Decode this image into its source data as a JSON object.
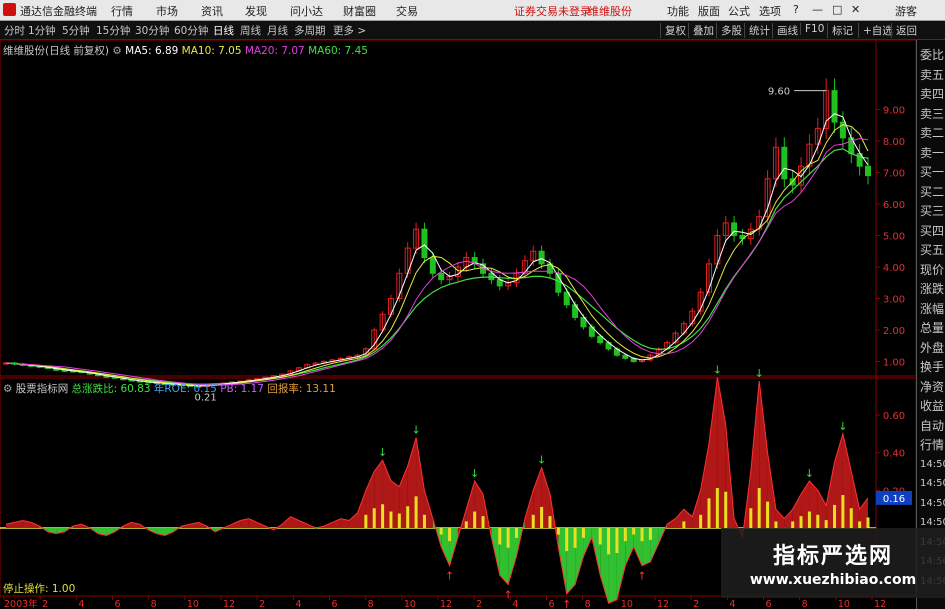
{
  "menubar": {
    "app_title": "通达信金融终端",
    "menus": [
      "行情",
      "市场",
      "资讯",
      "发现",
      "问小达",
      "财富圈",
      "交易"
    ],
    "login_text": "证券交易未登录",
    "stock_link": "维维股份",
    "right_menus": [
      "功能",
      "版面",
      "公式",
      "选项"
    ],
    "guest": "游客"
  },
  "timeframes": [
    "分时",
    "1分钟",
    "5分钟",
    "15分钟",
    "30分钟",
    "60分钟",
    "日线",
    "周线",
    "月线",
    "多周期",
    "更多 >"
  ],
  "selected_timeframe": "日线",
  "toolbar": [
    "复权",
    "叠加",
    "多股",
    "统计",
    "画线",
    "F10",
    "标记",
    "+自选",
    "返回"
  ],
  "main_legend": {
    "stock": "维维股份(日线 前复权)",
    "ma5": "MA5: 6.89",
    "ma10": "MA10: 7.05",
    "ma20": "MA20: 7.07",
    "ma60": "MA60: 7.45"
  },
  "price_axis": [
    "9.00",
    "8.00",
    "7.00",
    "6.00",
    "5.00",
    "4.00",
    "3.00",
    "2.00",
    "1.00"
  ],
  "price_annotations": {
    "high": "9.60",
    "low": "0.21"
  },
  "indicator_legend": {
    "name": "股票指标网",
    "total": "总涨跌比: 60.83",
    "roe": "年ROE: 0.15",
    "pb": "PB: 1.17",
    "ret": "回报率: 13.11"
  },
  "indicator_axis": [
    "0.60",
    "0.40",
    "0.20"
  ],
  "indicator_current": "0.16",
  "stop_text": "停止操作: 1.00",
  "x_axis": [
    "2003年",
    "2",
    "4",
    "6",
    "8",
    "10",
    "12",
    "2",
    "4",
    "6",
    "8",
    "10",
    "12",
    "2",
    "4",
    "6",
    "8",
    "10",
    "12",
    "2",
    "4",
    "6",
    "8",
    "10",
    "12"
  ],
  "side_labels": [
    "委比",
    "卖五",
    "卖四",
    "卖三",
    "卖二",
    "卖一",
    "买一",
    "买二",
    "买三",
    "买四",
    "买五",
    "现价",
    "涨跌",
    "涨幅",
    "总量",
    "外盘",
    "换手",
    "净资",
    "收益",
    "自动",
    "行情",
    "14:50",
    "14:50",
    "14:50",
    "14:50",
    "14:50",
    "14:50",
    "14:50"
  ],
  "watermark": {
    "title": "指标严选网",
    "url": "www.xuezhibiao.com"
  },
  "colors": {
    "ma5": "#ffffff",
    "ma10": "#e8e840",
    "ma20": "#e040e0",
    "ma60": "#40e040",
    "up": "#e02020",
    "down": "#20c020",
    "grid": "#8b0000"
  },
  "chart_data": {
    "type": "line",
    "title": "维维股份(日线 前复权)",
    "ylim": [
      0,
      10
    ],
    "price_series": [
      0.95,
      0.92,
      0.88,
      0.85,
      0.82,
      0.78,
      0.72,
      0.7,
      0.68,
      0.65,
      0.6,
      0.55,
      0.5,
      0.48,
      0.42,
      0.38,
      0.35,
      0.33,
      0.3,
      0.28,
      0.26,
      0.24,
      0.22,
      0.21,
      0.25,
      0.28,
      0.32,
      0.35,
      0.38,
      0.42,
      0.45,
      0.5,
      0.55,
      0.6,
      0.7,
      0.8,
      0.9,
      0.95,
      1.0,
      1.05,
      1.1,
      1.15,
      1.2,
      1.4,
      2.0,
      2.5,
      3.0,
      3.8,
      4.6,
      5.2,
      4.3,
      3.8,
      3.6,
      3.7,
      4.0,
      4.3,
      4.1,
      3.8,
      3.6,
      3.4,
      3.5,
      3.8,
      4.2,
      4.5,
      4.1,
      3.8,
      3.2,
      2.8,
      2.4,
      2.1,
      1.8,
      1.6,
      1.4,
      1.2,
      1.1,
      1.0,
      1.05,
      1.2,
      1.4,
      1.6,
      1.9,
      2.2,
      2.6,
      3.2,
      4.1,
      5.0,
      5.4,
      5.0,
      4.9,
      5.2,
      5.6,
      6.8,
      7.8,
      6.8,
      6.6,
      7.2,
      7.9,
      8.4,
      9.6,
      8.6,
      8.1,
      7.6,
      7.2,
      6.9
    ],
    "ma60_series": [
      0.95,
      0.93,
      0.9,
      0.88,
      0.85,
      0.82,
      0.78,
      0.75,
      0.72,
      0.69,
      0.66,
      0.62,
      0.58,
      0.55,
      0.51,
      0.47,
      0.44,
      0.41,
      0.38,
      0.35,
      0.33,
      0.31,
      0.29,
      0.28,
      0.28,
      0.29,
      0.3,
      0.32,
      0.34,
      0.36,
      0.39,
      0.42,
      0.46,
      0.5,
      0.55,
      0.61,
      0.67,
      0.73,
      0.8,
      0.86,
      0.92,
      0.98,
      1.05,
      1.15,
      1.3,
      1.5,
      1.75,
      2.05,
      2.4,
      2.75,
      3.0,
      3.2,
      3.35,
      3.45,
      3.52,
      3.6,
      3.65,
      3.68,
      3.68,
      3.66,
      3.64,
      3.64,
      3.66,
      3.7,
      3.7,
      3.65,
      3.55,
      3.4,
      3.2,
      2.98,
      2.75,
      2.52,
      2.28,
      2.05,
      1.85,
      1.67,
      1.52,
      1.42,
      1.38,
      1.4,
      1.48,
      1.62,
      1.8,
      2.05,
      2.4,
      2.85,
      3.3,
      3.7,
      4.05,
      4.4,
      4.8,
      5.3,
      5.85,
      6.2,
      6.45,
      6.7,
      6.95,
      7.2,
      7.5,
      7.7,
      7.75,
      7.6,
      7.5,
      7.45
    ],
    "indicator_series": [
      0.02,
      0.03,
      0.04,
      0.03,
      0.01,
      -0.02,
      -0.03,
      -0.02,
      0.01,
      0.02,
      0.0,
      -0.03,
      -0.04,
      -0.02,
      0.01,
      0.03,
      0.02,
      -0.01,
      -0.03,
      -0.04,
      -0.02,
      0.01,
      0.02,
      0.03,
      0.01,
      -0.02,
      0.0,
      0.02,
      0.04,
      0.05,
      0.03,
      0.01,
      -0.01,
      0.02,
      0.06,
      0.04,
      0.02,
      0.0,
      0.01,
      0.03,
      0.05,
      0.04,
      0.08,
      0.2,
      0.3,
      0.36,
      0.25,
      0.22,
      0.33,
      0.48,
      0.2,
      0.05,
      -0.1,
      -0.2,
      -0.05,
      0.1,
      0.25,
      0.18,
      -0.05,
      -0.25,
      -0.3,
      -0.15,
      0.05,
      0.2,
      0.32,
      0.18,
      -0.1,
      -0.35,
      -0.3,
      -0.15,
      -0.05,
      -0.25,
      -0.4,
      -0.38,
      -0.2,
      -0.1,
      -0.2,
      -0.18,
      -0.08,
      0.02,
      0.05,
      0.1,
      0.06,
      0.2,
      0.45,
      0.8,
      0.55,
      0.05,
      -0.05,
      0.3,
      0.78,
      0.4,
      0.1,
      0.05,
      0.1,
      0.18,
      0.25,
      0.2,
      0.12,
      0.35,
      0.5,
      0.3,
      0.1,
      0.16
    ]
  }
}
